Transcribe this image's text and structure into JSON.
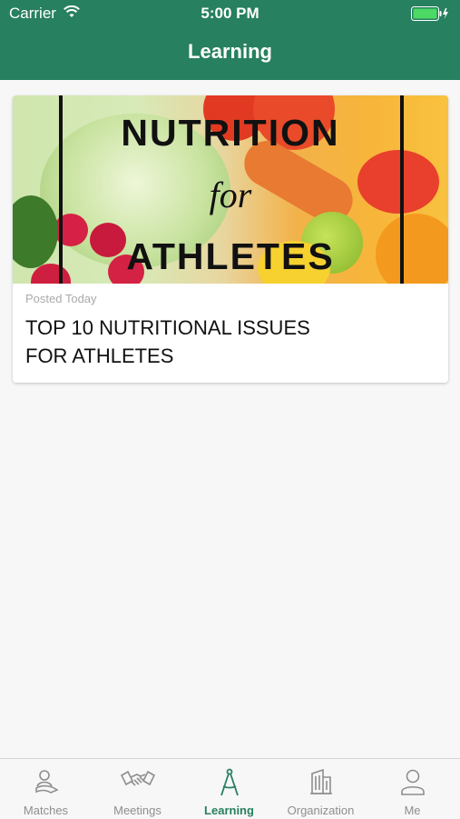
{
  "status": {
    "carrier": "Carrier",
    "time": "5:00 PM"
  },
  "nav": {
    "title": "Learning"
  },
  "post": {
    "hero_line1": "NUTRITION",
    "hero_line2": "for",
    "hero_line3": "ATHLETES",
    "posted": "Posted Today",
    "title_line1": "TOP 10 NUTRITIONAL ISSUES",
    "title_line2": "FOR ATHLETES"
  },
  "tabs": [
    {
      "label": "Matches",
      "icon": "matches-icon"
    },
    {
      "label": "Meetings",
      "icon": "handshake-icon"
    },
    {
      "label": "Learning",
      "icon": "compass-icon",
      "active": true
    },
    {
      "label": "Organization",
      "icon": "building-icon"
    },
    {
      "label": "Me",
      "icon": "person-icon"
    }
  ],
  "colors": {
    "brand": "#27805f",
    "background": "#f7f7f7",
    "tab_inactive": "#8e8e8e"
  }
}
